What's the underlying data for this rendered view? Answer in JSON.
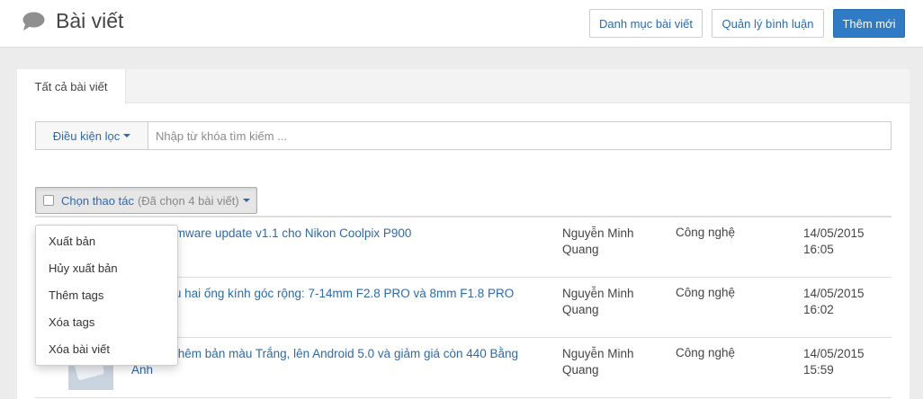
{
  "header": {
    "title": "Bài viết",
    "icon": "comment-icon",
    "buttons": [
      {
        "label": "Danh mục bài viết"
      },
      {
        "label": "Quản lý bình luận"
      },
      {
        "label": "Thêm mới"
      }
    ]
  },
  "tabs": [
    {
      "label": "Tất cả bài viết",
      "active": true
    }
  ],
  "filter": {
    "label": "Điều kiện lọc",
    "placeholder": "Nhập từ khóa tìm kiếm ..."
  },
  "bulk_action": {
    "label": "Chọn thao tác",
    "selected_text": "(Đã chọn 4 bài viết)"
  },
  "menu": {
    "items": [
      {
        "label": "Xuất bản"
      },
      {
        "label": "Hủy xuất bản"
      },
      {
        "label": "Thêm tags"
      },
      {
        "label": "Xóa tags"
      },
      {
        "label": "Xóa bài viết"
      }
    ]
  },
  "rows": [
    {
      "title": "ng bố firmware update v1.1 cho Nikon Coolpix P900",
      "author": "Nguyễn Minh Quang",
      "category": "Công nghệ",
      "date": "14/05/2015",
      "time": "16:05"
    },
    {
      "title": "giới thiệu hai ống kính góc rộng: 7-14mm F2.8 PRO và 8mm F1.8 PRO",
      "author": "Nguyễn Minh Quang",
      "category": "Công nghệ",
      "date": "14/05/2015",
      "time": "16:02"
    },
    {
      "title": "ne 2 có thêm bản màu Trắng, lên Android 5.0 và giảm giá còn 440 Bằng Anh",
      "author": "Nguyễn Minh Quang",
      "category": "Công nghệ",
      "date": "14/05/2015",
      "time": "15:59"
    }
  ],
  "colors": {
    "link": "#2a6ab0",
    "primary": "#2f7bc6",
    "background": "#ececec"
  }
}
